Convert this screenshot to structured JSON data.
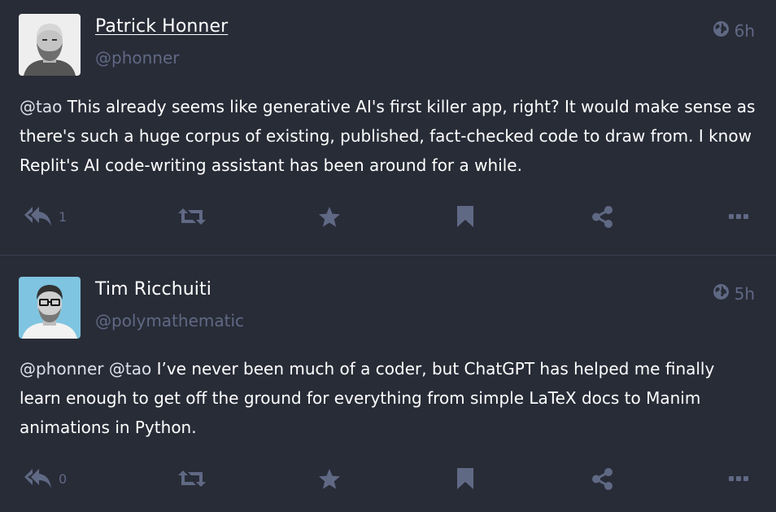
{
  "posts": [
    {
      "author": {
        "display_name": "Patrick Honner",
        "handle": "@phonner",
        "avatar_icon": "avatar-photo-bald-bearded-man"
      },
      "visibility_icon": "globe-icon",
      "time": "6h",
      "content": {
        "mention": "@tao",
        "text": "This already seems like generative AI's first killer app, right? It would make sense as there's such a huge corpus of existing, published, fact-checked code to draw from. I know Replit's AI code-writing assistant has been around for a while."
      },
      "reply_count": "1"
    },
    {
      "author": {
        "display_name": "Tim Ricchuiti",
        "handle": "@polymathematic",
        "avatar_icon": "avatar-photo-man-with-glasses"
      },
      "visibility_icon": "globe-icon",
      "time": "5h",
      "content": {
        "mention1": "@phonner",
        "mention2": "@tao",
        "text": "I’ve never been much of a coder, but ChatGPT has helped me finally learn enough to get off the ground for everything from simple LaTeX docs to Manim animations in Python."
      },
      "reply_count": "0"
    }
  ],
  "actions": [
    "reply-all-icon",
    "boost-icon",
    "star-icon",
    "bookmark-icon",
    "share-icon",
    "ellipsis-icon"
  ],
  "colors": {
    "background": "#282c37",
    "muted": "#606984",
    "text": "#ffffff",
    "divider": "#393f4f"
  }
}
